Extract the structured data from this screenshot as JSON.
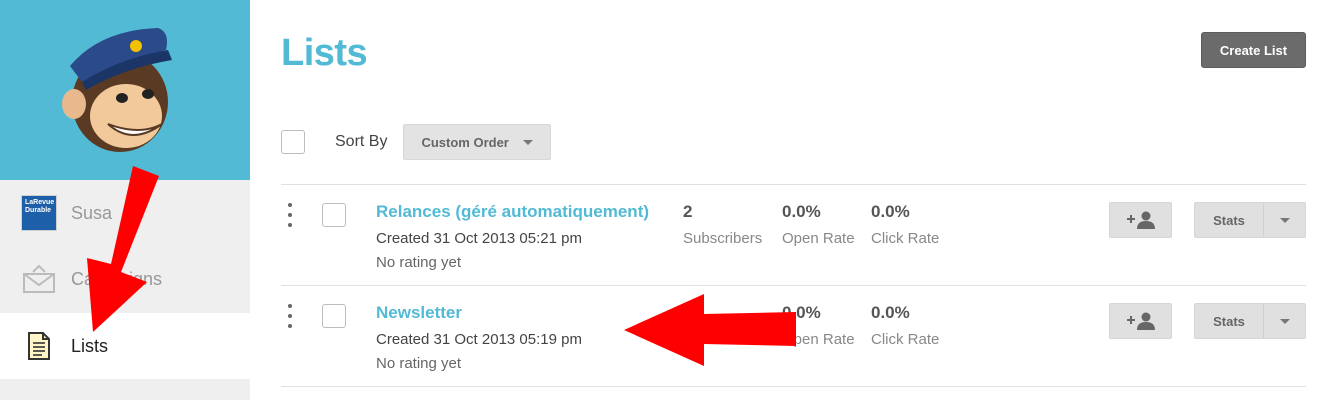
{
  "sidebar": {
    "items": [
      {
        "label": "Susa",
        "icon": "account-logo-icon",
        "logo_text": "LaRevue Durable"
      },
      {
        "label": "Campaigns",
        "icon": "mail-tray-icon"
      },
      {
        "label": "Lists",
        "icon": "document-list-icon"
      }
    ]
  },
  "header": {
    "title": "Lists",
    "create_button": "Create List"
  },
  "sort": {
    "label": "Sort By",
    "selected": "Custom Order"
  },
  "lists": [
    {
      "name": "Relances (géré automatiquement)",
      "created": "Created 31 Oct 2013 05:21 pm",
      "rating": "No rating yet",
      "subscribers": "2",
      "subscribers_label": "Subscribers",
      "open_rate": "0.0%",
      "open_rate_label": "Open Rate",
      "click_rate": "0.0%",
      "click_rate_label": "Click Rate",
      "stats_label": "Stats"
    },
    {
      "name": "Newsletter",
      "created": "Created 31 Oct 2013 05:19 pm",
      "rating": "No rating yet",
      "open_rate": "0.0%",
      "open_rate_label": "Open Rate",
      "click_rate": "0.0%",
      "click_rate_label": "Click Rate",
      "stats_label": "Stats"
    }
  ],
  "colors": {
    "accent": "#52bad5",
    "annotation_arrow": "#ff0000",
    "button_dark": "#6b6b6b"
  }
}
